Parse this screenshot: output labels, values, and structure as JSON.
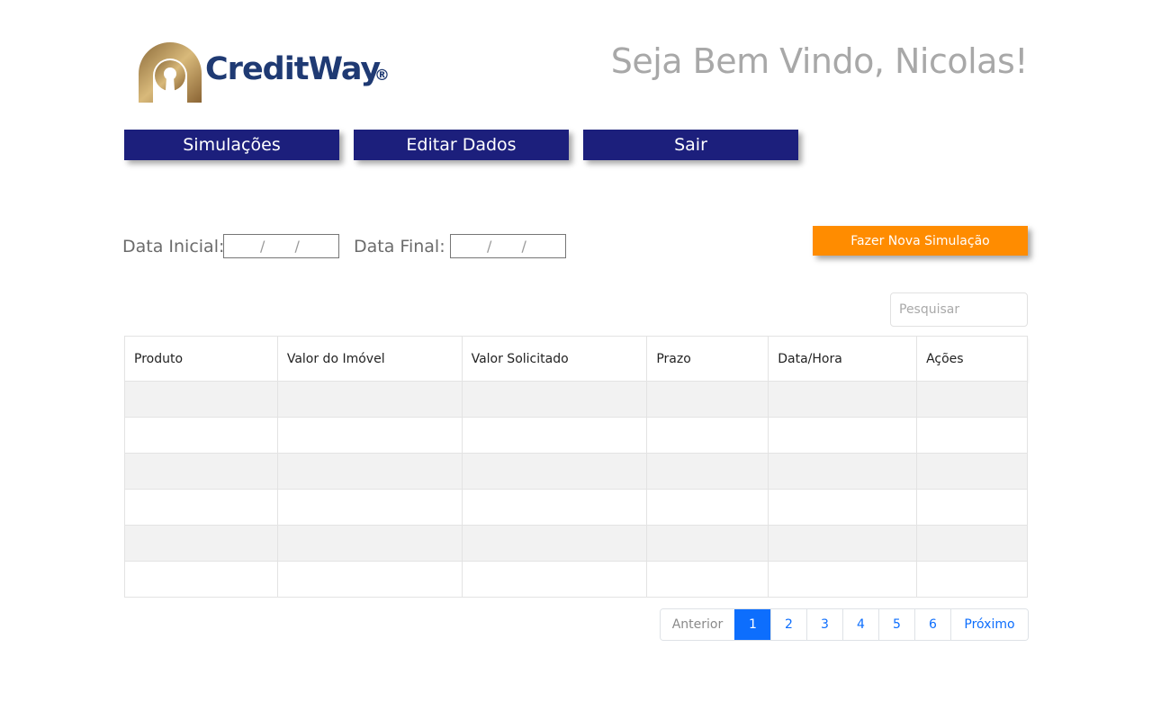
{
  "header": {
    "logo_text": "CreditWay",
    "logo_reg": "®",
    "welcome": "Seja Bem Vindo, Nicolas!"
  },
  "nav": {
    "simulations": "Simulações",
    "edit_data": "Editar Dados",
    "logout": "Sair"
  },
  "filters": {
    "start_label": "Data Inicial:",
    "start_value": "/ /",
    "end_label": "Data Final:",
    "end_value": "/ /"
  },
  "actions": {
    "new_simulation": "Fazer Nova Simulação"
  },
  "search": {
    "placeholder": "Pesquisar"
  },
  "table": {
    "columns": [
      "Produto",
      "Valor do Imóvel",
      "Valor Solicitado",
      "Prazo",
      "Data/Hora",
      "Ações"
    ]
  },
  "pagination": {
    "prev": "Anterior",
    "pages": [
      "1",
      "2",
      "3",
      "4",
      "5",
      "6"
    ],
    "next": "Próximo",
    "current": "1"
  },
  "colors": {
    "nav_bg": "#1c1f7c",
    "action_orange": "#ff8c00",
    "brand_blue": "#1f3a73",
    "brand_gold": "#b8934f",
    "pager_active": "#0d6efd"
  }
}
